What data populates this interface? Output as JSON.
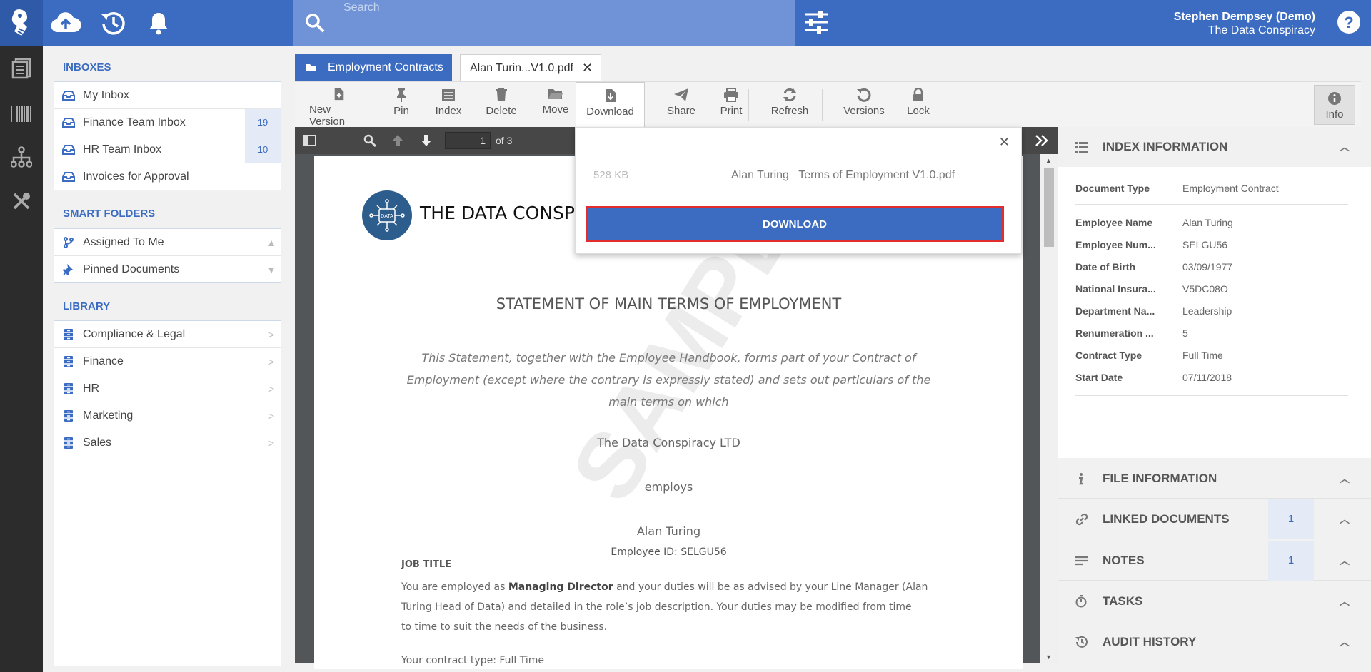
{
  "header": {
    "search_placeholder": "Search",
    "user_name": "Stephen Dempsey (Demo)",
    "org_name": "The Data Conspiracy"
  },
  "sidebar": {
    "inboxes_title": "INBOXES",
    "inboxes": [
      {
        "label": "My Inbox",
        "count": ""
      },
      {
        "label": "Finance Team Inbox",
        "count": "19"
      },
      {
        "label": "HR Team Inbox",
        "count": "10"
      },
      {
        "label": "Invoices for Approval",
        "count": ""
      }
    ],
    "smart_title": "SMART FOLDERS",
    "smart": [
      {
        "label": "Assigned To Me"
      },
      {
        "label": "Pinned Documents"
      }
    ],
    "library_title": "LIBRARY",
    "library": [
      {
        "label": "Compliance & Legal"
      },
      {
        "label": "Finance"
      },
      {
        "label": "HR"
      },
      {
        "label": "Marketing"
      },
      {
        "label": "Sales"
      }
    ]
  },
  "tabs": {
    "folder": "Employment Contracts",
    "doc": "Alan Turin...V1.0.pdf"
  },
  "toolbar": {
    "new_version": "New Version",
    "pin": "Pin",
    "index": "Index",
    "delete": "Delete",
    "move": "Move",
    "download": "Download",
    "share": "Share",
    "print": "Print",
    "refresh": "Refresh",
    "versions": "Versions",
    "lock": "Lock",
    "info": "Info"
  },
  "viewer": {
    "page_current": "1",
    "page_total": "of 3"
  },
  "popup": {
    "size": "528 KB",
    "filename": "Alan Turing _Terms of Employment V1.0.pdf",
    "button": "DOWNLOAD"
  },
  "document": {
    "company_header": "THE DATA CONSPI",
    "title": "STATEMENT OF MAIN TERMS OF EMPLOYMENT",
    "intro1": "This Statement, together with the Employee Handbook, forms part of your Contract of",
    "intro2": "Employment (except where the contrary is expressly stated) and sets out particulars of the",
    "intro3": "main terms on which",
    "company": "The Data Conspiracy LTD",
    "employs": "employs",
    "employee": "Alan Turing",
    "employee_id": "Employee ID: SELGU56",
    "job_title": "JOB TITLE",
    "body1_a": "You are employed as ",
    "body1_b": "Managing Director",
    "body1_c": " and your duties will be as advised by your Line Manager (Alan",
    "body2": "Turing Head of Data) and detailed in the role’s job description. Your duties may be modified from time",
    "body3": "to time to suit the needs of the business.",
    "body4": "Your contract type: Full Time",
    "watermark": "SAMPLE DATA"
  },
  "index_info": {
    "title": "INDEX INFORMATION",
    "doc_type_label": "Document Type",
    "doc_type_value": "Employment Contract",
    "fields": [
      {
        "k": "Employee Name",
        "v": "Alan Turing"
      },
      {
        "k": "Employee Num...",
        "v": "SELGU56"
      },
      {
        "k": "Date of Birth",
        "v": "03/09/1977"
      },
      {
        "k": "National Insura...",
        "v": "V5DC08O"
      },
      {
        "k": "Department Na...",
        "v": "Leadership"
      },
      {
        "k": "Renumeration ...",
        "v": "5"
      },
      {
        "k": "Contract Type",
        "v": "Full Time"
      },
      {
        "k": "Start Date",
        "v": "07/11/2018"
      }
    ]
  },
  "sections": {
    "file_info": "FILE INFORMATION",
    "linked": "LINKED DOCUMENTS",
    "linked_count": "1",
    "notes": "NOTES",
    "notes_count": "1",
    "tasks": "TASKS",
    "audit": "AUDIT HISTORY"
  }
}
